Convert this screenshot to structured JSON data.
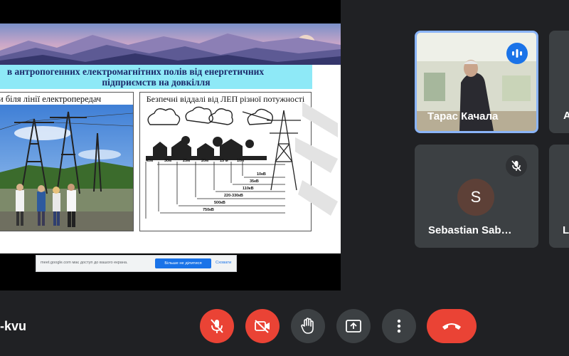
{
  "slide": {
    "title_line1": "в антропогенних електромагнітних полів від енергетичних",
    "title_line2": "підприємств на довкілля",
    "left_caption": "и біля лінії електропередач",
    "right_caption": "Безпечні віддалі від ЛЕП різної потужності",
    "diagram": {
      "distances": [
        "40м",
        "30м",
        "25м",
        "20м",
        "15 м",
        "10м"
      ],
      "voltages": [
        "10кВ",
        "35кВ",
        "110кВ",
        "220-330кВ",
        "500кВ",
        "750кВ"
      ]
    }
  },
  "share_notice": {
    "text": "meet.google.com має доступ до вашого екрана.",
    "stop_label": "Більше не ділитися",
    "hide_label": "Сховати"
  },
  "participants": [
    {
      "name": "Тарас Качала",
      "active_speaker": true,
      "indicator": "audio-level-icon"
    },
    {
      "name": "A",
      "partial": true
    },
    {
      "name": "Sebastian Sab…",
      "avatar_letter": "S",
      "avatar_color": "#5d4037",
      "muted": true
    },
    {
      "name": "L",
      "partial": true
    }
  ],
  "meeting": {
    "code": "-kvu"
  },
  "controls": [
    {
      "name": "microphone-off",
      "icon": "mic-off-icon",
      "color": "#ea4335"
    },
    {
      "name": "camera-off",
      "icon": "videocam-off-icon",
      "color": "#ea4335"
    },
    {
      "name": "raise-hand",
      "icon": "hand-icon"
    },
    {
      "name": "present-screen",
      "icon": "present-icon"
    },
    {
      "name": "more-options",
      "icon": "more-vert-icon"
    },
    {
      "name": "leave-call",
      "icon": "call-end-icon",
      "color": "#ea4335"
    }
  ],
  "colors": {
    "background": "#202124",
    "tile": "#3c4043",
    "accent": "#8ab4f8",
    "danger": "#ea4335",
    "title_box": "#8ee9f7"
  }
}
